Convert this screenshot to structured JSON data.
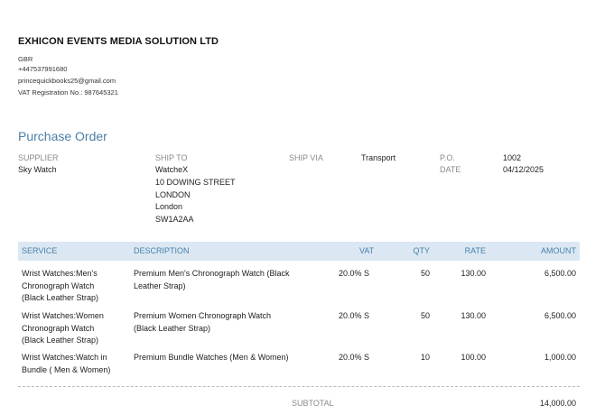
{
  "company": {
    "name": "EXHICON EVENTS MEDIA SOLUTION LTD",
    "country": "GBR",
    "phone": "+447537991680",
    "email": "princequickbooks25@gmail.com",
    "vat_registration": "VAT Registration No.: 987645321"
  },
  "document_title": "Purchase Order",
  "meta": {
    "supplier_label": "SUPPLIER",
    "supplier": "Sky Watch",
    "ship_to_label": "SHIP TO",
    "ship_to": [
      "WatcheX",
      "10 DOWING STREET",
      "LONDON",
      "London",
      "SW1A2AA"
    ],
    "ship_via_label": "SHIP VIA",
    "ship_via": "Transport",
    "po_label": "P.O.",
    "po": "1002",
    "date_label": "DATE",
    "date": "04/12/2025"
  },
  "table": {
    "headers": {
      "service": "SERVICE",
      "description": "DESCRIPTION",
      "vat": "VAT",
      "qty": "QTY",
      "rate": "RATE",
      "amount": "AMOUNT"
    },
    "rows": [
      {
        "service": [
          "Wrist Watches:Men's",
          "Chronograph Watch",
          "(Black Leather Strap)"
        ],
        "description": [
          "Premium Men's Chronograph Watch (Black",
          "Leather Strap)"
        ],
        "vat": "20.0% S",
        "qty": "50",
        "rate": "130.00",
        "amount": "6,500.00"
      },
      {
        "service": [
          "Wrist Watches:Women",
          "Chronograph Watch",
          "(Black Leather Strap)"
        ],
        "description": [
          "Premium Women Chronograph Watch",
          "(Black Leather Strap)"
        ],
        "vat": "20.0% S",
        "qty": "50",
        "rate": "130.00",
        "amount": "6,500.00"
      },
      {
        "service": [
          "Wrist Watches:Watch in",
          "Bundle ( Men & Women)"
        ],
        "description": [
          "Premium Bundle Watches (Men & Women)"
        ],
        "vat": "20.0% S",
        "qty": "10",
        "rate": "100.00",
        "amount": "1,000.00"
      }
    ]
  },
  "subtotal": {
    "label": "SUBTOTAL",
    "value": "14,000.00"
  }
}
